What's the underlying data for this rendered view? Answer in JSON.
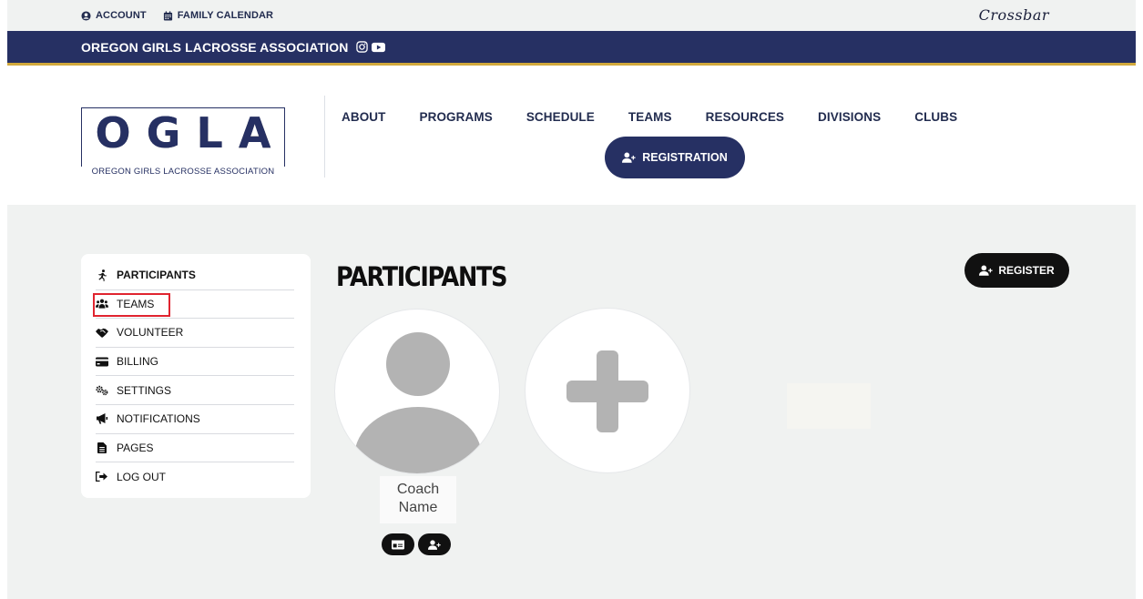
{
  "topbar": {
    "account_label": "ACCOUNT",
    "calendar_label": "FAMILY CALENDAR",
    "brand": "Crossbar"
  },
  "assoc": {
    "name": "OREGON GIRLS LACROSSE ASSOCIATION"
  },
  "logo": {
    "letters": [
      "O",
      "G",
      "L",
      "A"
    ],
    "subtitle": "OREGON GIRLS LACROSSE ASSOCIATION"
  },
  "nav": {
    "items": [
      "ABOUT",
      "PROGRAMS",
      "SCHEDULE",
      "TEAMS",
      "RESOURCES",
      "DIVISIONS",
      "CLUBS"
    ],
    "registration_label": "REGISTRATION"
  },
  "sidebar": {
    "items": [
      {
        "label": "PARTICIPANTS",
        "icon": "running-person-icon"
      },
      {
        "label": "TEAMS",
        "icon": "users-icon"
      },
      {
        "label": "VOLUNTEER",
        "icon": "handshake-icon"
      },
      {
        "label": "BILLING",
        "icon": "credit-card-icon"
      },
      {
        "label": "SETTINGS",
        "icon": "gears-icon"
      },
      {
        "label": "NOTIFICATIONS",
        "icon": "megaphone-icon"
      },
      {
        "label": "PAGES",
        "icon": "file-icon"
      },
      {
        "label": "LOG OUT",
        "icon": "sign-out-icon"
      }
    ],
    "highlighted": "TEAMS"
  },
  "main": {
    "title": "PARTICIPANTS",
    "register_label": "REGISTER",
    "participant": {
      "name_line1": "Coach",
      "name_line2": "Name"
    }
  },
  "colors": {
    "navy": "#263063",
    "gold": "#d2a93c",
    "highlight_red": "#e0242f",
    "content_bg": "#f0f2f1"
  }
}
